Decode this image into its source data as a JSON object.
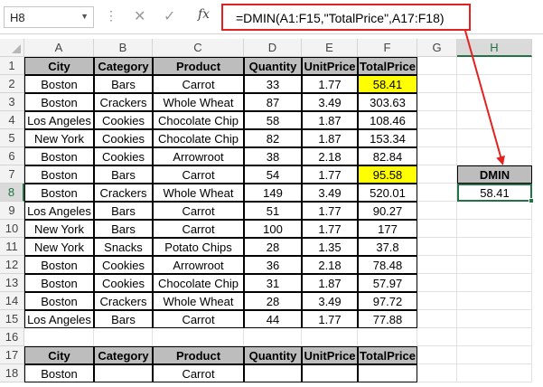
{
  "formula_bar": {
    "name_box": "H8",
    "cancel_icon": "✕",
    "enter_icon": "✓",
    "fx_label": "fx",
    "formula": "=DMIN(A1:F15,\"TotalPrice\",A17:F18)"
  },
  "columns": [
    "A",
    "B",
    "C",
    "D",
    "E",
    "F",
    "G",
    "H"
  ],
  "rows": [
    "1",
    "2",
    "3",
    "4",
    "5",
    "6",
    "7",
    "8",
    "9",
    "10",
    "11",
    "12",
    "13",
    "14",
    "15",
    "16",
    "17",
    "18"
  ],
  "table": {
    "headers": [
      "City",
      "Category",
      "Product",
      "Quantity",
      "UnitPrice",
      "TotalPrice"
    ],
    "rows": [
      [
        "Boston",
        "Bars",
        "Carrot",
        "33",
        "1.77",
        "58.41"
      ],
      [
        "Boston",
        "Crackers",
        "Whole Wheat",
        "87",
        "3.49",
        "303.63"
      ],
      [
        "Los Angeles",
        "Cookies",
        "Chocolate Chip",
        "58",
        "1.87",
        "108.46"
      ],
      [
        "New York",
        "Cookies",
        "Chocolate Chip",
        "82",
        "1.87",
        "153.34"
      ],
      [
        "Boston",
        "Cookies",
        "Arrowroot",
        "38",
        "2.18",
        "82.84"
      ],
      [
        "Boston",
        "Bars",
        "Carrot",
        "54",
        "1.77",
        "95.58"
      ],
      [
        "Boston",
        "Crackers",
        "Whole Wheat",
        "149",
        "3.49",
        "520.01"
      ],
      [
        "Los Angeles",
        "Bars",
        "Carrot",
        "51",
        "1.77",
        "90.27"
      ],
      [
        "New York",
        "Bars",
        "Carrot",
        "100",
        "1.77",
        "177"
      ],
      [
        "New York",
        "Snacks",
        "Potato Chips",
        "28",
        "1.35",
        "37.8"
      ],
      [
        "Boston",
        "Cookies",
        "Arrowroot",
        "36",
        "2.18",
        "78.48"
      ],
      [
        "Boston",
        "Cookies",
        "Chocolate Chip",
        "31",
        "1.87",
        "57.97"
      ],
      [
        "Boston",
        "Crackers",
        "Whole Wheat",
        "28",
        "3.49",
        "97.72"
      ],
      [
        "Los Angeles",
        "Bars",
        "Carrot",
        "44",
        "1.77",
        "77.88"
      ]
    ]
  },
  "criteria": {
    "headers": [
      "City",
      "Category",
      "Product",
      "Quantity",
      "UnitPrice",
      "TotalPrice"
    ],
    "row": [
      "Boston",
      "",
      "Carrot",
      "",
      "",
      ""
    ]
  },
  "result": {
    "header": "DMIN",
    "value": "58.41"
  },
  "colors": {
    "highlight": "#ffff00",
    "header_fill": "#bdbdbd",
    "annotation_red": "#e3221f",
    "excel_green": "#217346"
  }
}
